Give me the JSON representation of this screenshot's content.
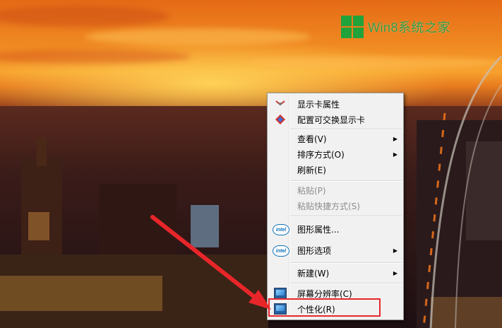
{
  "watermark": {
    "text": "Win8系统之家"
  },
  "context_menu": {
    "items": [
      {
        "label": "显示卡属性",
        "icon": "graphics-card-icon",
        "disabled": false,
        "submenu": false
      },
      {
        "label": "配置可交换显示卡",
        "icon": "switchable-graphics-icon",
        "disabled": false,
        "submenu": false
      },
      {
        "label": "查看(V)",
        "icon": "",
        "disabled": false,
        "submenu": true
      },
      {
        "label": "排序方式(O)",
        "icon": "",
        "disabled": false,
        "submenu": true
      },
      {
        "label": "刷新(E)",
        "icon": "",
        "disabled": false,
        "submenu": false
      },
      {
        "label": "粘贴(P)",
        "icon": "",
        "disabled": true,
        "submenu": false
      },
      {
        "label": "粘贴快捷方式(S)",
        "icon": "",
        "disabled": true,
        "submenu": false
      },
      {
        "label": "图形属性...",
        "icon": "intel-icon",
        "disabled": false,
        "submenu": false
      },
      {
        "label": "图形选项",
        "icon": "intel-icon",
        "disabled": false,
        "submenu": true
      },
      {
        "label": "新建(W)",
        "icon": "",
        "disabled": false,
        "submenu": true
      },
      {
        "label": "屏幕分辨率(C)",
        "icon": "monitor-icon",
        "disabled": false,
        "submenu": false
      },
      {
        "label": "个性化(R)",
        "icon": "personalize-icon",
        "disabled": false,
        "submenu": false
      }
    ],
    "intel_badge": "intel"
  },
  "annotation": {
    "highlight_color": "#e8262a",
    "arrow_color": "#e8262a"
  }
}
